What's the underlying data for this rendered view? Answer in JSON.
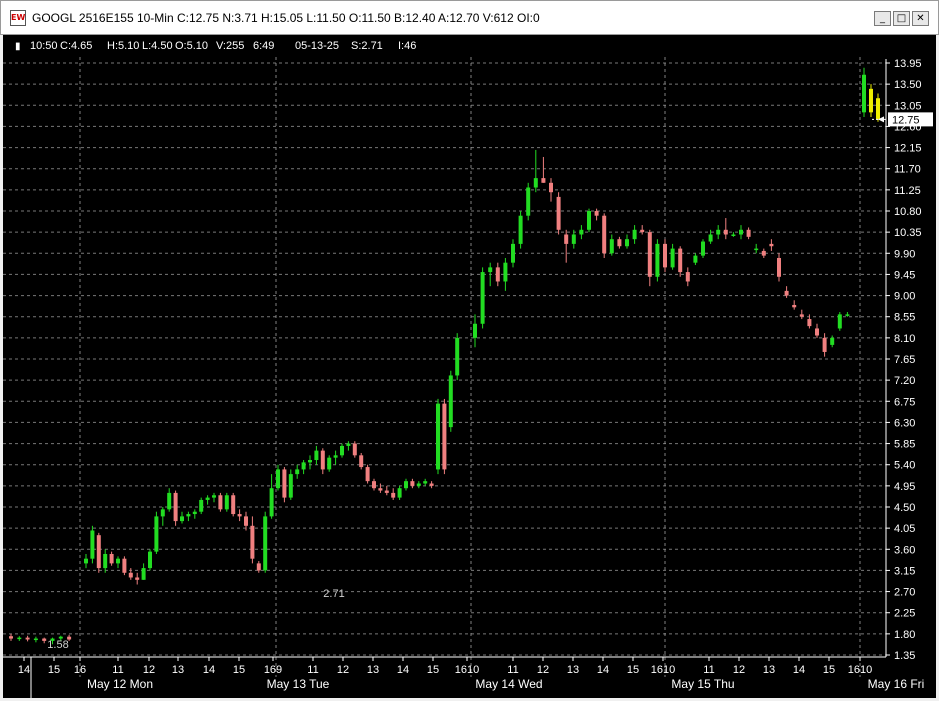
{
  "window": {
    "title": "GOOGL 2516E155 10-Min C:12.75 N:3.71 H:15.05 L:11.50 O:11.50 B:12.40 A:12.70 V:612 OI:0",
    "app_icon": "chart-window-icon",
    "buttons": [
      {
        "name": "minimize-button",
        "glyph": "_"
      },
      {
        "name": "maximize-button",
        "glyph": "□"
      },
      {
        "name": "close-button",
        "glyph": "✕"
      }
    ]
  },
  "info_bar": {
    "items": [
      "10:50",
      "C:4.65",
      "H:5.10",
      "L:4.50",
      "O:5.10",
      "V:255",
      "6:49",
      "05-13-25",
      "S:2.71",
      "I:46"
    ]
  },
  "annotations": {
    "low_label": "2.71",
    "start_label": "1.58"
  },
  "colors": {
    "up": "#22dd22",
    "down": "#f08080",
    "current": "#eeee00",
    "background": "#000000",
    "grid": "#a0a0a0"
  },
  "chart_data": {
    "type": "candlestick",
    "symbol": "GOOGL 2516E155",
    "interval": "10-Min",
    "y_ticks": [
      "13.95",
      "13.50",
      "13.05",
      "12.60",
      "12.15",
      "11.70",
      "11.25",
      "10.80",
      "10.35",
      "9.90",
      "9.45",
      "9.00",
      "8.55",
      "8.10",
      "7.65",
      "7.20",
      "6.75",
      "6.30",
      "5.85",
      "5.40",
      "4.95",
      "4.50",
      "4.05",
      "3.60",
      "3.15",
      "2.70",
      "2.25",
      "1.80",
      "1.35"
    ],
    "ylim": [
      1.35,
      13.95
    ],
    "last_price": "12.75",
    "x_hour_labels": [
      "14",
      "15",
      "16",
      "11",
      "12",
      "13",
      "14",
      "15",
      "169",
      "11",
      "12",
      "13",
      "14",
      "15",
      "1610",
      "11",
      "12",
      "13",
      "14",
      "15",
      "1610",
      "11",
      "12",
      "13",
      "14",
      "15",
      "1610"
    ],
    "day_labels": [
      "May 12 Mon",
      "May 13 Tue",
      "May 14 Wed",
      "May 15 Thu",
      "May 16 Fri"
    ],
    "candles": [
      {
        "o": 1.75,
        "h": 1.8,
        "l": 1.65,
        "c": 1.7
      },
      {
        "o": 1.7,
        "h": 1.75,
        "l": 1.65,
        "c": 1.72
      },
      {
        "o": 1.72,
        "h": 1.76,
        "l": 1.64,
        "c": 1.68
      },
      {
        "o": 1.68,
        "h": 1.74,
        "l": 1.62,
        "c": 1.7
      },
      {
        "o": 1.7,
        "h": 1.72,
        "l": 1.6,
        "c": 1.65
      },
      {
        "o": 1.65,
        "h": 1.72,
        "l": 1.58,
        "c": 1.7
      },
      {
        "o": 1.7,
        "h": 1.76,
        "l": 1.66,
        "c": 1.74
      },
      {
        "o": 1.74,
        "h": 1.78,
        "l": 1.65,
        "c": 1.68
      },
      {
        "o": 3.3,
        "h": 3.5,
        "l": 3.2,
        "c": 3.4
      },
      {
        "o": 3.4,
        "h": 4.1,
        "l": 3.3,
        "c": 4.0
      },
      {
        "o": 3.9,
        "h": 3.95,
        "l": 3.1,
        "c": 3.2
      },
      {
        "o": 3.2,
        "h": 3.6,
        "l": 3.1,
        "c": 3.5
      },
      {
        "o": 3.5,
        "h": 3.55,
        "l": 3.25,
        "c": 3.3
      },
      {
        "o": 3.3,
        "h": 3.45,
        "l": 3.2,
        "c": 3.4
      },
      {
        "o": 3.4,
        "h": 3.45,
        "l": 3.05,
        "c": 3.1
      },
      {
        "o": 3.1,
        "h": 3.2,
        "l": 2.95,
        "c": 3.0
      },
      {
        "o": 3.0,
        "h": 3.1,
        "l": 2.85,
        "c": 2.95
      },
      {
        "o": 2.95,
        "h": 3.3,
        "l": 2.95,
        "c": 3.2
      },
      {
        "o": 3.2,
        "h": 3.6,
        "l": 3.15,
        "c": 3.55
      },
      {
        "o": 3.55,
        "h": 4.4,
        "l": 3.5,
        "c": 4.3
      },
      {
        "o": 4.3,
        "h": 4.5,
        "l": 4.1,
        "c": 4.45
      },
      {
        "o": 4.45,
        "h": 4.9,
        "l": 4.4,
        "c": 4.8
      },
      {
        "o": 4.8,
        "h": 4.85,
        "l": 4.1,
        "c": 4.2
      },
      {
        "o": 4.2,
        "h": 4.4,
        "l": 4.15,
        "c": 4.3
      },
      {
        "o": 4.3,
        "h": 4.4,
        "l": 4.2,
        "c": 4.35
      },
      {
        "o": 4.35,
        "h": 4.45,
        "l": 4.25,
        "c": 4.4
      },
      {
        "o": 4.4,
        "h": 4.7,
        "l": 4.35,
        "c": 4.65
      },
      {
        "o": 4.65,
        "h": 4.75,
        "l": 4.55,
        "c": 4.7
      },
      {
        "o": 4.7,
        "h": 4.8,
        "l": 4.6,
        "c": 4.75
      },
      {
        "o": 4.75,
        "h": 4.8,
        "l": 4.4,
        "c": 4.45
      },
      {
        "o": 4.45,
        "h": 4.8,
        "l": 4.4,
        "c": 4.75
      },
      {
        "o": 4.75,
        "h": 4.8,
        "l": 4.3,
        "c": 4.35
      },
      {
        "o": 4.35,
        "h": 4.45,
        "l": 4.2,
        "c": 4.3
      },
      {
        "o": 4.3,
        "h": 4.4,
        "l": 4.0,
        "c": 4.1
      },
      {
        "o": 4.1,
        "h": 4.3,
        "l": 3.3,
        "c": 3.4
      },
      {
        "o": 3.3,
        "h": 3.35,
        "l": 3.1,
        "c": 3.15
      },
      {
        "o": 3.15,
        "h": 4.4,
        "l": 3.1,
        "c": 4.3
      },
      {
        "o": 4.3,
        "h": 5.2,
        "l": 4.25,
        "c": 4.9
      },
      {
        "o": 4.9,
        "h": 5.4,
        "l": 4.85,
        "c": 5.3
      },
      {
        "o": 5.3,
        "h": 5.35,
        "l": 4.6,
        "c": 4.7
      },
      {
        "o": 4.7,
        "h": 5.3,
        "l": 4.65,
        "c": 5.2
      },
      {
        "o": 5.2,
        "h": 5.4,
        "l": 5.1,
        "c": 5.3
      },
      {
        "o": 5.3,
        "h": 5.5,
        "l": 5.2,
        "c": 5.45
      },
      {
        "o": 5.45,
        "h": 5.6,
        "l": 5.3,
        "c": 5.5
      },
      {
        "o": 5.5,
        "h": 5.8,
        "l": 5.4,
        "c": 5.7
      },
      {
        "o": 5.7,
        "h": 5.75,
        "l": 5.2,
        "c": 5.3
      },
      {
        "o": 5.3,
        "h": 5.6,
        "l": 5.25,
        "c": 5.55
      },
      {
        "o": 5.55,
        "h": 5.7,
        "l": 5.4,
        "c": 5.6
      },
      {
        "o": 5.6,
        "h": 5.85,
        "l": 5.55,
        "c": 5.8
      },
      {
        "o": 5.8,
        "h": 5.9,
        "l": 5.7,
        "c": 5.85
      },
      {
        "o": 5.85,
        "h": 5.9,
        "l": 5.55,
        "c": 5.6
      },
      {
        "o": 5.6,
        "h": 5.65,
        "l": 5.3,
        "c": 5.35
      },
      {
        "o": 5.35,
        "h": 5.4,
        "l": 5.0,
        "c": 5.05
      },
      {
        "o": 5.05,
        "h": 5.1,
        "l": 4.85,
        "c": 4.9
      },
      {
        "o": 4.9,
        "h": 5.0,
        "l": 4.8,
        "c": 4.85
      },
      {
        "o": 4.85,
        "h": 4.95,
        "l": 4.75,
        "c": 4.8
      },
      {
        "o": 4.8,
        "h": 4.9,
        "l": 4.65,
        "c": 4.7
      },
      {
        "o": 4.7,
        "h": 4.95,
        "l": 4.65,
        "c": 4.9
      },
      {
        "o": 4.9,
        "h": 5.1,
        "l": 4.85,
        "c": 5.05
      },
      {
        "o": 5.05,
        "h": 5.1,
        "l": 4.9,
        "c": 4.95
      },
      {
        "o": 4.95,
        "h": 5.05,
        "l": 4.9,
        "c": 5.0
      },
      {
        "o": 5.0,
        "h": 5.1,
        "l": 4.95,
        "c": 5.05
      },
      {
        "o": 5.0,
        "h": 5.05,
        "l": 4.9,
        "c": 4.95
      },
      {
        "o": 5.3,
        "h": 6.8,
        "l": 5.2,
        "c": 6.7
      },
      {
        "o": 6.7,
        "h": 6.8,
        "l": 5.2,
        "c": 5.3
      },
      {
        "o": 6.2,
        "h": 7.4,
        "l": 6.1,
        "c": 7.3
      },
      {
        "o": 7.3,
        "h": 8.2,
        "l": 7.2,
        "c": 8.1
      },
      {
        "o": 8.1,
        "h": 8.6,
        "l": 7.9,
        "c": 8.4
      },
      {
        "o": 8.4,
        "h": 9.6,
        "l": 8.3,
        "c": 9.5
      },
      {
        "o": 9.5,
        "h": 9.7,
        "l": 9.2,
        "c": 9.6
      },
      {
        "o": 9.6,
        "h": 9.7,
        "l": 9.2,
        "c": 9.3
      },
      {
        "o": 9.3,
        "h": 9.8,
        "l": 9.1,
        "c": 9.7
      },
      {
        "o": 9.7,
        "h": 10.2,
        "l": 9.6,
        "c": 10.1
      },
      {
        "o": 10.1,
        "h": 10.8,
        "l": 10.0,
        "c": 10.7
      },
      {
        "o": 10.7,
        "h": 11.4,
        "l": 10.6,
        "c": 11.3
      },
      {
        "o": 11.3,
        "h": 12.1,
        "l": 11.2,
        "c": 11.5
      },
      {
        "o": 11.5,
        "h": 11.95,
        "l": 11.4,
        "c": 11.4
      },
      {
        "o": 11.4,
        "h": 11.5,
        "l": 11.0,
        "c": 11.2
      },
      {
        "o": 11.1,
        "h": 11.2,
        "l": 10.3,
        "c": 10.4
      },
      {
        "o": 10.3,
        "h": 10.4,
        "l": 9.7,
        "c": 10.1
      },
      {
        "o": 10.1,
        "h": 10.4,
        "l": 10.0,
        "c": 10.3
      },
      {
        "o": 10.3,
        "h": 10.5,
        "l": 10.2,
        "c": 10.4
      },
      {
        "o": 10.4,
        "h": 10.85,
        "l": 10.35,
        "c": 10.8
      },
      {
        "o": 10.8,
        "h": 10.85,
        "l": 10.6,
        "c": 10.7
      },
      {
        "o": 10.7,
        "h": 10.75,
        "l": 9.8,
        "c": 9.9
      },
      {
        "o": 9.9,
        "h": 10.3,
        "l": 9.85,
        "c": 10.2
      },
      {
        "o": 10.2,
        "h": 10.25,
        "l": 10.0,
        "c": 10.05
      },
      {
        "o": 10.05,
        "h": 10.3,
        "l": 10.0,
        "c": 10.2
      },
      {
        "o": 10.2,
        "h": 10.5,
        "l": 10.1,
        "c": 10.4
      },
      {
        "o": 10.4,
        "h": 10.5,
        "l": 10.3,
        "c": 10.35
      },
      {
        "o": 10.35,
        "h": 10.4,
        "l": 9.2,
        "c": 9.4
      },
      {
        "o": 9.4,
        "h": 10.2,
        "l": 9.3,
        "c": 10.1
      },
      {
        "o": 10.1,
        "h": 10.2,
        "l": 9.5,
        "c": 9.6
      },
      {
        "o": 9.6,
        "h": 10.1,
        "l": 9.55,
        "c": 10.0
      },
      {
        "o": 10.0,
        "h": 10.05,
        "l": 9.4,
        "c": 9.5
      },
      {
        "o": 9.5,
        "h": 9.6,
        "l": 9.2,
        "c": 9.3
      },
      {
        "o": 9.7,
        "h": 9.9,
        "l": 9.65,
        "c": 9.85
      },
      {
        "o": 9.85,
        "h": 10.2,
        "l": 9.8,
        "c": 10.15
      },
      {
        "o": 10.15,
        "h": 10.4,
        "l": 10.1,
        "c": 10.3
      },
      {
        "o": 10.3,
        "h": 10.5,
        "l": 10.2,
        "c": 10.4
      },
      {
        "o": 10.4,
        "h": 10.65,
        "l": 10.2,
        "c": 10.3
      },
      {
        "o": 10.3,
        "h": 10.35,
        "l": 10.25,
        "c": 10.3
      },
      {
        "o": 10.3,
        "h": 10.5,
        "l": 10.2,
        "c": 10.4
      },
      {
        "o": 10.4,
        "h": 10.45,
        "l": 10.2,
        "c": 10.25
      },
      {
        "o": 10.0,
        "h": 10.1,
        "l": 9.9,
        "c": 10.0
      },
      {
        "o": 9.95,
        "h": 10.0,
        "l": 9.8,
        "c": 9.85
      },
      {
        "o": 10.1,
        "h": 10.2,
        "l": 9.95,
        "c": 10.05
      },
      {
        "o": 9.8,
        "h": 9.9,
        "l": 9.3,
        "c": 9.4
      },
      {
        "o": 9.1,
        "h": 9.2,
        "l": 8.95,
        "c": 9.0
      },
      {
        "o": 8.8,
        "h": 8.9,
        "l": 8.7,
        "c": 8.75
      },
      {
        "o": 8.6,
        "h": 8.7,
        "l": 8.5,
        "c": 8.55
      },
      {
        "o": 8.5,
        "h": 8.6,
        "l": 8.3,
        "c": 8.35
      },
      {
        "o": 8.3,
        "h": 8.4,
        "l": 8.1,
        "c": 8.15
      },
      {
        "o": 8.1,
        "h": 8.2,
        "l": 7.7,
        "c": 7.8
      },
      {
        "o": 7.95,
        "h": 8.15,
        "l": 7.9,
        "c": 8.1
      },
      {
        "o": 8.3,
        "h": 8.65,
        "l": 8.25,
        "c": 8.6
      },
      {
        "o": 8.6,
        "h": 8.65,
        "l": 8.55,
        "c": 8.6
      },
      {
        "o": 12.9,
        "h": 13.85,
        "l": 12.8,
        "c": 13.7
      },
      {
        "o": 13.4,
        "h": 13.5,
        "l": 12.8,
        "c": 12.9
      },
      {
        "o": 13.2,
        "h": 13.3,
        "l": 12.7,
        "c": 12.75
      }
    ]
  }
}
